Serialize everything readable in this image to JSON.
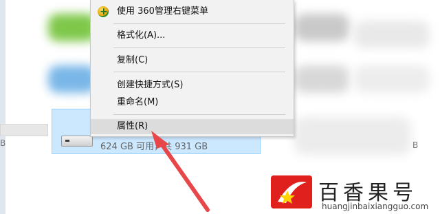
{
  "menu": {
    "items": [
      {
        "label": "使用 360管理右键菜单",
        "icon": "360-icon"
      },
      {
        "label": "格式化(A)..."
      },
      {
        "label": "复制(C)"
      },
      {
        "label": "创建快捷方式(S)"
      },
      {
        "label": "重命名(M)"
      },
      {
        "label": "属性(R)"
      }
    ]
  },
  "drive": {
    "free_text": "624 GB 可用，共 931 GB"
  },
  "edge": {
    "left_b": "B",
    "right_b": "B"
  },
  "watermark": {
    "title": "百香果号",
    "url": "huangjinbaixiangguo.com"
  },
  "colors": {
    "arrow": "#e8474a",
    "selection": "#cce8ff",
    "menu_bg": "#f2f2f2",
    "logo_red": "#e0201c"
  }
}
